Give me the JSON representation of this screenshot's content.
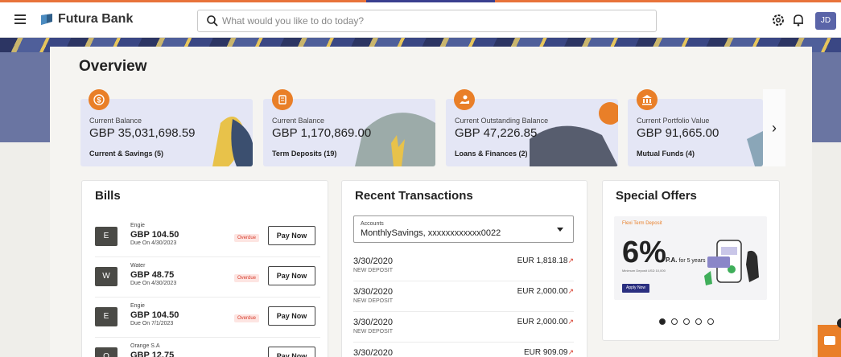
{
  "header": {
    "brand": "Futura Bank",
    "search_placeholder": "What would you like to do today?",
    "avatar_initials": "JD",
    "icons": [
      "menu-icon",
      "bank-logo-icon",
      "search-icon",
      "settings-icon",
      "bell-icon"
    ]
  },
  "overview": {
    "title": "Overview",
    "cards": [
      {
        "label": "Current Balance",
        "amount": "GBP 35,031,698.59",
        "sub": "Current & Savings (5)",
        "icon": "dollar-icon"
      },
      {
        "label": "Current Balance",
        "amount": "GBP 1,170,869.00",
        "sub": "Term Deposits (19)",
        "icon": "deposit-icon"
      },
      {
        "label": "Current Outstanding Balance",
        "amount": "GBP 47,226.85",
        "sub": "Loans & Finances (2)",
        "icon": "loan-icon"
      },
      {
        "label": "Current Portfolio Value",
        "amount": "GBP 91,665.00",
        "sub": "Mutual Funds (4)",
        "icon": "bank-icon"
      }
    ],
    "next_arrow": "›"
  },
  "bills": {
    "title": "Bills",
    "items": [
      {
        "initial": "E",
        "name": "Engie",
        "amount": "GBP 104.50",
        "due": "Due On 4/30/2023",
        "status": "Overdue",
        "action": "Pay Now"
      },
      {
        "initial": "W",
        "name": "Water",
        "amount": "GBP 48.75",
        "due": "Due On 4/30/2023",
        "status": "Overdue",
        "action": "Pay Now"
      },
      {
        "initial": "E",
        "name": "Engie",
        "amount": "GBP 104.50",
        "due": "Due On 7/1/2023",
        "status": "Overdue",
        "action": "Pay Now"
      },
      {
        "initial": "O",
        "name": "Orange S.A",
        "amount": "GBP 12.75",
        "due": "",
        "status": "",
        "action": "Pay Now"
      }
    ]
  },
  "transactions": {
    "title": "Recent Transactions",
    "account_label": "Accounts",
    "account_value": "MonthlySavings, xxxxxxxxxxxx0022",
    "items": [
      {
        "date": "3/30/2020",
        "type": "NEW DEPOSIT",
        "amount": "EUR 1,818.18"
      },
      {
        "date": "3/30/2020",
        "type": "NEW DEPOSIT",
        "amount": "EUR 2,000.00"
      },
      {
        "date": "3/30/2020",
        "type": "NEW DEPOSIT",
        "amount": "EUR 2,000.00"
      },
      {
        "date": "3/30/2020",
        "type": "",
        "amount": "EUR 909.09"
      }
    ],
    "arrow": "↗"
  },
  "offers": {
    "title": "Special Offers",
    "tag": "Flexi Term Deposit",
    "rate": "6%",
    "rate_sub": "P.A.",
    "rate_term": "for 5 years",
    "min_text": "Minimum Deposit USD 10,000",
    "apply_label": "Apply Now",
    "slides": 5,
    "active_slide": 0
  },
  "colors": {
    "accent": "#e97f28",
    "brand_blue": "#2a2f80",
    "overdue": "#d73a2a"
  }
}
